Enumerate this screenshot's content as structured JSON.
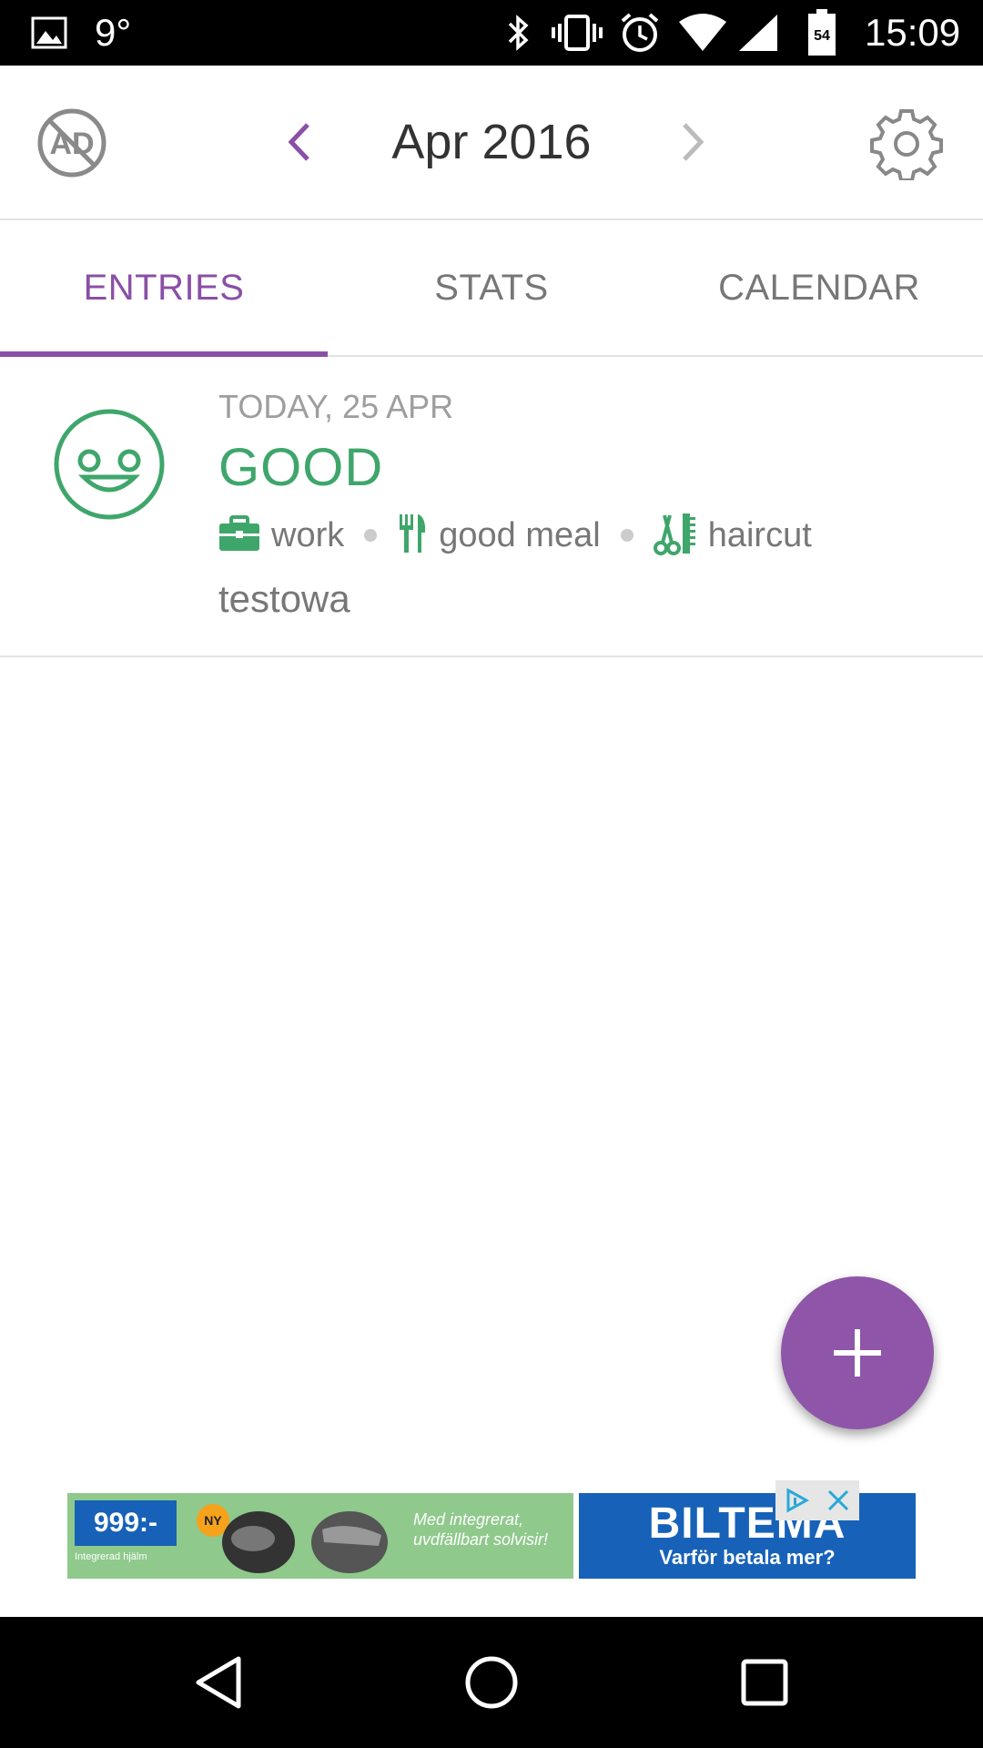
{
  "status_bar": {
    "temperature": "9°",
    "time": "15:09",
    "battery_level": "54",
    "icons": [
      "image-icon",
      "bluetooth-icon",
      "vibrate-icon",
      "alarm-icon",
      "wifi-icon",
      "signal-icon",
      "battery-icon"
    ]
  },
  "toolbar": {
    "month_title": "Apr 2016",
    "icons": [
      "no-ads-icon",
      "chevron-left-icon",
      "chevron-right-icon",
      "gear-icon"
    ]
  },
  "tabs": [
    {
      "label": "ENTRIES",
      "active": true
    },
    {
      "label": "STATS",
      "active": false
    },
    {
      "label": "CALENDAR",
      "active": false
    }
  ],
  "entry": {
    "date": "TODAY, 25 APR",
    "mood": "GOOD",
    "mood_icon": "smiley-face-icon",
    "activities": [
      {
        "icon": "briefcase-icon",
        "label": "work"
      },
      {
        "icon": "fork-knife-icon",
        "label": "good meal"
      },
      {
        "icon": "scissors-comb-icon",
        "label": "haircut"
      }
    ],
    "note": "testowa"
  },
  "fab": {
    "icon": "plus-icon"
  },
  "ad": {
    "price": "999:-",
    "small_text": "Integrerad hjälm",
    "badge": "NY",
    "slogan": "Med integrerat, uvdfällbart solvisir!",
    "brand": "BILTEMA",
    "tagline": "Varför betala mer?"
  },
  "colors": {
    "accent": "#8a4fa6",
    "mood_good": "#3fa66b",
    "fab": "#8e55a8"
  },
  "nav_bar": {
    "icons": [
      "back-icon",
      "home-icon",
      "recents-icon"
    ]
  }
}
